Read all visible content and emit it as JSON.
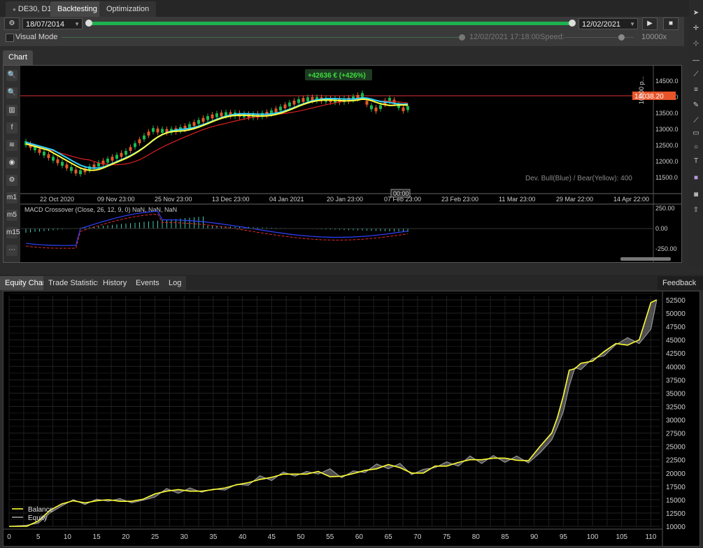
{
  "header": {
    "symbol_tab": "DE30, D1",
    "tabs": [
      "Backtesting",
      "Optimization"
    ]
  },
  "controls": {
    "start_date": "18/07/2014",
    "end_date": "12/02/2021",
    "visual_mode_label": "Visual Mode",
    "current_time": "12/02/2021 17:18:00",
    "speed_label": "Speed:",
    "speed_value": "10000x",
    "progress_fraction": 1.0
  },
  "chart_panel": {
    "tab": "Chart",
    "profit_badge": "+42636 € (+426%)",
    "price_marker": "14038.20",
    "volume_label": "10000 p...",
    "dev_text": "Dev. Bull(Blue) / Bear(Yellow):  400",
    "macd_label": "MACD Crossover (Close, 26, 12, 9, 0) NaN, NaN, NaN",
    "crosshair_label": "00:00",
    "price_axis": [
      "14500.0",
      "14000.0",
      "13500.0",
      "13000.0",
      "12500.0",
      "12000.0",
      "11500.0"
    ],
    "time_axis": [
      "22 Oct 2020",
      "09 Nov 23:00",
      "25 Nov 23:00",
      "13 Dec 23:00",
      "04 Jan 2021",
      "20 Jan 23:00",
      "07 Feb 23:00",
      "23 Feb 23:00",
      "11 Mar 23:00",
      "29 Mar 22:00",
      "14 Apr 22:00"
    ],
    "macd_axis": [
      "250.00",
      "0.00",
      "-250.00"
    ],
    "left_tools": [
      "zoom-in",
      "zoom-out",
      "bar-chart",
      "social",
      "layers",
      "eye",
      "settings",
      "m1",
      "m5",
      "m15",
      "more"
    ],
    "left_tool_glyphs": [
      "🔍",
      "🔍",
      "▥",
      "f",
      "≋",
      "◉",
      "⚙",
      "m1",
      "m5",
      "m15",
      "⋯"
    ]
  },
  "bottom_tabs": [
    "Equity Chart",
    "Trade Statistics",
    "History",
    "Events",
    "Log"
  ],
  "feedback_label": "Feedback",
  "chart_data": {
    "type": "line",
    "title": "",
    "xlabel": "",
    "ylabel": "",
    "xlim": [
      0,
      111
    ],
    "ylim": [
      10000,
      52500
    ],
    "x_ticks": [
      0,
      5,
      10,
      15,
      20,
      25,
      30,
      35,
      40,
      45,
      50,
      55,
      60,
      65,
      70,
      75,
      80,
      85,
      90,
      95,
      100,
      105,
      110
    ],
    "y_ticks": [
      10000,
      12500,
      15000,
      17500,
      20000,
      22500,
      25000,
      27500,
      30000,
      32500,
      35000,
      37500,
      40000,
      42500,
      45000,
      47500,
      50000,
      52500
    ],
    "legend": [
      "Balance",
      "Equity"
    ],
    "legend_position": "bottom-left",
    "colors": {
      "Balance": "#ffff33",
      "Equity": "#9a9a9a"
    },
    "series": [
      {
        "name": "Balance",
        "x": [
          0,
          3,
          5,
          7,
          9,
          11,
          13,
          15,
          17,
          19,
          21,
          23,
          25,
          27,
          29,
          31,
          33,
          35,
          37,
          39,
          41,
          43,
          45,
          47,
          49,
          51,
          53,
          55,
          57,
          59,
          61,
          63,
          65,
          67,
          69,
          71,
          73,
          75,
          77,
          79,
          81,
          83,
          85,
          87,
          89,
          91,
          93,
          94,
          95,
          96,
          97,
          98,
          100,
          102,
          104,
          106,
          108,
          110,
          111
        ],
        "y": [
          10000,
          10000,
          11000,
          13000,
          14200,
          14800,
          14400,
          14800,
          15000,
          14700,
          14700,
          15100,
          16100,
          16600,
          16900,
          16600,
          16600,
          16900,
          17200,
          17800,
          18200,
          18800,
          19200,
          19800,
          19800,
          19800,
          20300,
          19300,
          19400,
          19900,
          20500,
          20800,
          21600,
          21000,
          20000,
          20000,
          21300,
          21300,
          22000,
          22500,
          22500,
          22800,
          22800,
          22400,
          22300,
          25000,
          27500,
          30500,
          34500,
          39300,
          39600,
          40600,
          41000,
          42800,
          44300,
          44000,
          45000,
          52000,
          52500
        ]
      },
      {
        "name": "Equity",
        "x": [
          0,
          3,
          5,
          7,
          9,
          11,
          13,
          15,
          17,
          19,
          21,
          23,
          25,
          27,
          29,
          31,
          33,
          35,
          37,
          39,
          41,
          43,
          45,
          47,
          49,
          51,
          53,
          55,
          57,
          59,
          61,
          63,
          65,
          67,
          69,
          71,
          73,
          75,
          77,
          79,
          81,
          83,
          85,
          87,
          89,
          91,
          93,
          94,
          95,
          96,
          97,
          98,
          100,
          102,
          104,
          106,
          108,
          110,
          111
        ],
        "y": [
          10000,
          10200,
          10600,
          12500,
          13800,
          15000,
          14100,
          15100,
          14700,
          15200,
          14400,
          14900,
          15500,
          17100,
          16200,
          17200,
          16400,
          17000,
          16800,
          17900,
          17700,
          19500,
          18600,
          20200,
          19400,
          20300,
          19800,
          20800,
          19100,
          20400,
          20100,
          21700,
          20800,
          21800,
          19700,
          20700,
          21000,
          22100,
          21300,
          23200,
          21800,
          23300,
          22000,
          23200,
          21900,
          23800,
          26200,
          28700,
          31500,
          36300,
          39800,
          39400,
          41500,
          42000,
          44100,
          45400,
          44300,
          47000,
          52400
        ]
      }
    ]
  }
}
